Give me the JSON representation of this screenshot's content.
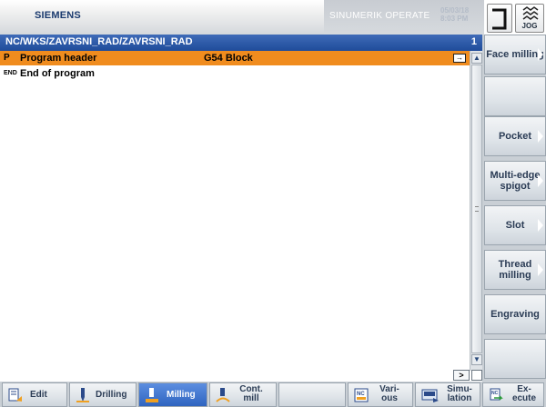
{
  "header": {
    "brand": "SIEMENS",
    "product": "SINUMERIK OPERATE",
    "date": "05/03/18",
    "time": "8:03 PM",
    "mode_label": "JOG"
  },
  "path_bar": {
    "path": "NC/WKS/ZAVRSNI_RAD/ZAVRSNI_RAD",
    "line_number": "1"
  },
  "program": {
    "rows": [
      {
        "tag": "P",
        "text": "Program header",
        "param": "G54 Block",
        "selected": true
      },
      {
        "tag": "END",
        "text": "End of program",
        "param": ""
      }
    ]
  },
  "expand_label": ">",
  "vertical_softkeys": [
    {
      "label": "Face milling",
      "arrow": true
    },
    {
      "label": "",
      "arrow": false
    },
    {
      "label": "Pocket",
      "arrow": true
    },
    {
      "label": "Multi-edge spigot",
      "arrow": true
    },
    {
      "label": "Slot",
      "arrow": true
    },
    {
      "label": "Thread milling",
      "arrow": true
    },
    {
      "label": "Engraving",
      "arrow": false
    },
    {
      "label": "",
      "arrow": false
    }
  ],
  "horizontal_softkeys": [
    {
      "label": "Edit",
      "icon": "edit-icon",
      "active": false
    },
    {
      "label": "Drilling",
      "icon": "drill-icon",
      "active": false
    },
    {
      "label": "Milling",
      "icon": "mill-icon",
      "active": true
    },
    {
      "label": "Cont. mill",
      "icon": "contour-mill-icon",
      "active": false
    },
    {
      "label": "",
      "icon": "",
      "active": false
    },
    {
      "label": "Vari- ous",
      "icon": "nc-icon",
      "active": false
    },
    {
      "label": "Simu- lation",
      "icon": "simulation-icon",
      "active": false
    },
    {
      "label": "Ex- ecute",
      "icon": "execute-icon",
      "active": false
    }
  ],
  "colors": {
    "path_bar": "#1f4c9a",
    "selected_row": "#f08c1e",
    "active_softkey": "#2f64c0",
    "softkey_text": "#2b3c55"
  }
}
